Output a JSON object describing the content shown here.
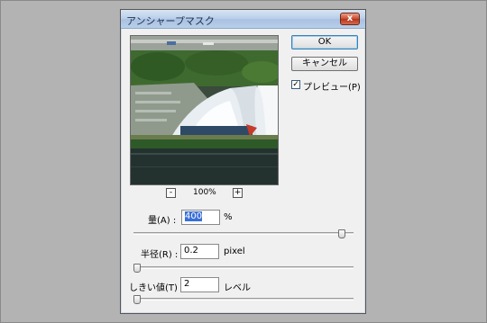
{
  "dialog": {
    "title": "アンシャープマスク",
    "close_label": "x"
  },
  "preview": {
    "zoom_out_label": "-",
    "zoom_level": "100%",
    "zoom_in_label": "+"
  },
  "buttons": {
    "ok_label": "OK",
    "cancel_label": "キャンセル"
  },
  "preview_toggle": {
    "checked": true,
    "check_mark": "✓",
    "label": "プレビュー(P)"
  },
  "fields": {
    "amount": {
      "label": "量(A) :",
      "value": "400",
      "unit": "%",
      "slider_fraction": 0.96
    },
    "radius": {
      "label": "半径(R) :",
      "value": "0.2",
      "unit": "pixel",
      "slider_fraction": 0.0
    },
    "threshold": {
      "label": "しきい値(T) :",
      "value": "2",
      "unit": "レベル",
      "slider_fraction": 0.0
    }
  }
}
